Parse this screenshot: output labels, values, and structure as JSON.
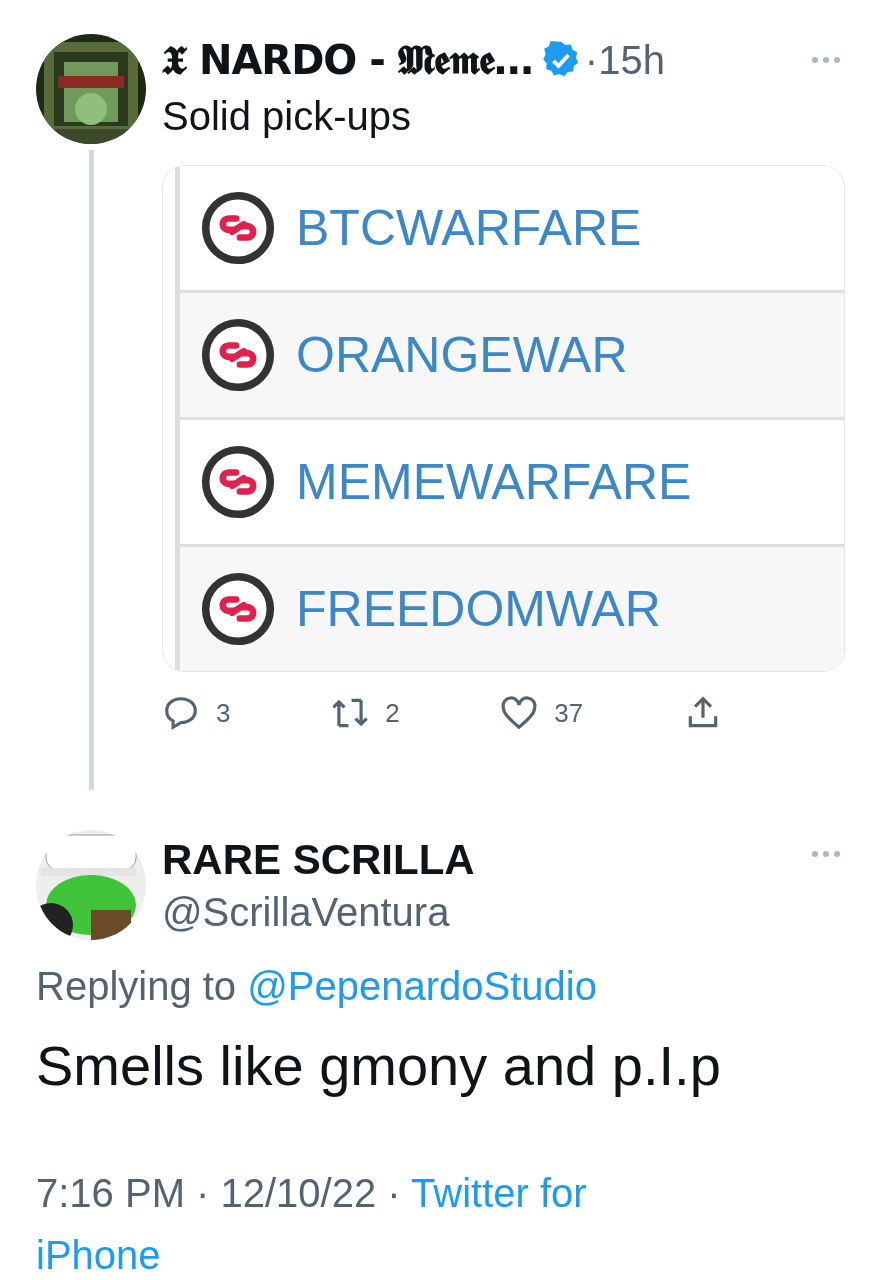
{
  "tweet": {
    "author": "𝖃 NARDO - 𝕸𝖊𝖒𝖊…",
    "verified": true,
    "time": "·15h",
    "text": "Solid pick-ups",
    "card_rows": [
      {
        "label": "BTCWARFARE"
      },
      {
        "label": "ORANGEWAR"
      },
      {
        "label": "MEMEWARFARE"
      },
      {
        "label": "FREEDOMWAR"
      }
    ],
    "actions": [
      {
        "kind": "reply",
        "count": "3"
      },
      {
        "kind": "retweet",
        "count": "2"
      },
      {
        "kind": "like",
        "count": "37"
      },
      {
        "kind": "share"
      }
    ]
  },
  "reply": {
    "name": "RARE SCRILLA",
    "handle": "@ScrillaVentura",
    "replying_to": "Replying to",
    "replying_handle": "@PepenardoStudio",
    "text": "Smells like gmony and p.I.p",
    "time": "7:16 PM · 12/10/22 ·",
    "source": "Twitter for iPhone"
  }
}
